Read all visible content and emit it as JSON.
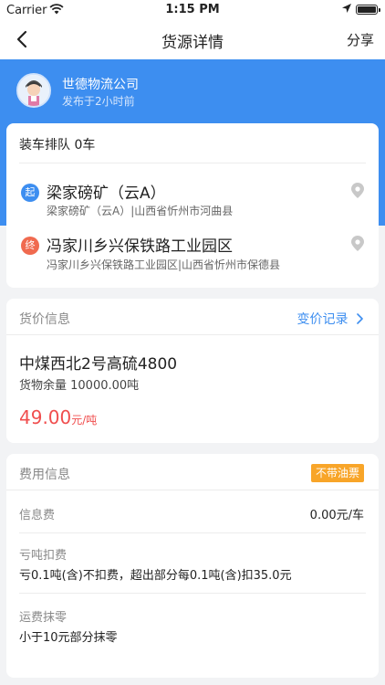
{
  "status_bar": {
    "carrier": "Carrier",
    "time": "1:15 PM"
  },
  "nav": {
    "title": "货源详情",
    "share_label": "分享"
  },
  "company": {
    "name": "世德物流公司",
    "posted": "发布于2小时前"
  },
  "route": {
    "queue_label": "装车排队 0车",
    "start": {
      "badge": "起",
      "name": "梁家磅矿（云A）",
      "address": "梁家磅矿（云A）|山西省忻州市河曲县"
    },
    "end": {
      "badge": "终",
      "name": "冯家川乡兴保铁路工业园区",
      "address": "冯家川乡兴保铁路工业园区|山西省忻州市保德县"
    }
  },
  "price_info": {
    "section_title": "货价信息",
    "change_log_label": "变价记录",
    "goods_name": "中煤西北2号高硫4800",
    "remaining": "货物余量 10000.00吨",
    "price_value": "49.00",
    "price_unit": "元/吨"
  },
  "fee_info": {
    "section_title": "费用信息",
    "badge": "不带油票",
    "info_fee_label": "信息费",
    "info_fee_value": "0.00元/车",
    "loss_label": "亏吨扣费",
    "loss_value": "亏0.1吨(含)不扣费，超出部分每0.1吨(含)扣35.0元",
    "rounding_label": "运费抹零",
    "rounding_value": "小于10元部分抹零"
  },
  "colors": {
    "primary": "#3d8ef0",
    "price": "#f04e4e",
    "badge": "#f8a529",
    "start": "#3d8ef0",
    "end": "#f06a4f"
  }
}
